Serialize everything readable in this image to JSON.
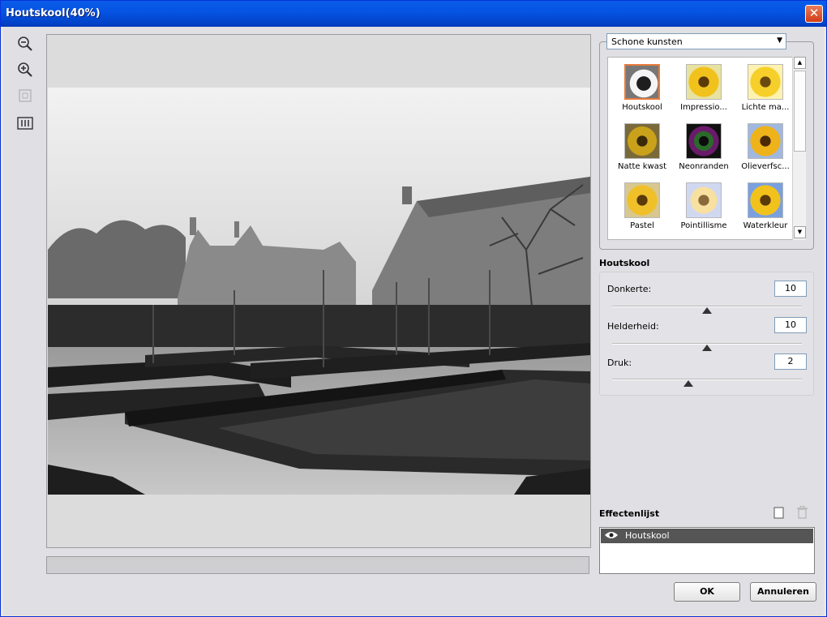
{
  "window": {
    "title": "Houtskool(40%)"
  },
  "toolbar": {
    "zoom_out_icon": "zoom-out-icon",
    "zoom_in_icon": "zoom-in-icon",
    "fit_icon": "fit-to-screen-icon",
    "actual_icon": "actual-size-icon"
  },
  "gallery": {
    "category": "Schone kunsten",
    "items": [
      {
        "label": "Houtskool",
        "selected": true
      },
      {
        "label": "Impressio..."
      },
      {
        "label": "Lichte ma..."
      },
      {
        "label": "Natte kwast"
      },
      {
        "label": "Neonranden"
      },
      {
        "label": "Olieverfsc..."
      },
      {
        "label": "Pastel"
      },
      {
        "label": "Pointillisme"
      },
      {
        "label": "Waterkleur"
      }
    ]
  },
  "settings": {
    "title": "Houtskool",
    "params": [
      {
        "label": "Donkerte:",
        "value": "10",
        "level": 0.5
      },
      {
        "label": "Helderheid:",
        "value": "10",
        "level": 0.5
      },
      {
        "label": "Druk:",
        "value": "2",
        "level": 0.4
      }
    ]
  },
  "effects": {
    "title": "Effectenlijst",
    "items": [
      {
        "label": "Houtskool"
      }
    ]
  },
  "buttons": {
    "ok": "OK",
    "cancel": "Annuleren"
  },
  "colors": {
    "title_bar": "#0553e2",
    "selection": "#e87b3c",
    "list_highlight": "#555555"
  }
}
